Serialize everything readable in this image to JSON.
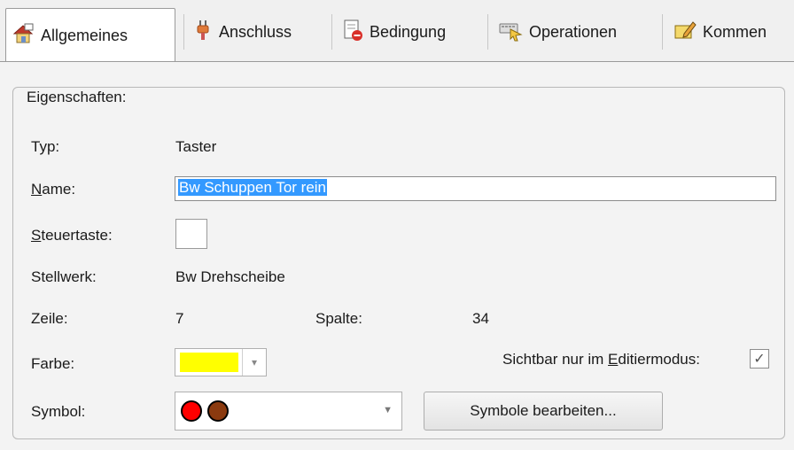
{
  "tabs": [
    {
      "label": "Allgemeines",
      "icon": "house-properties-icon",
      "active": true
    },
    {
      "label": "Anschluss",
      "icon": "plug-icon",
      "active": false
    },
    {
      "label": "Bedingung",
      "icon": "document-condition-icon",
      "active": false
    },
    {
      "label": "Operationen",
      "icon": "keyboard-pointer-icon",
      "active": false
    },
    {
      "label": "Kommen",
      "icon": "note-pencil-icon",
      "active": false
    }
  ],
  "group": {
    "title": "Eigenschaften:"
  },
  "fields": {
    "typ_label": "Typ:",
    "typ_value": "Taster",
    "name_label_u": "N",
    "name_label_rest": "ame:",
    "name_value": "Bw Schuppen Tor rein",
    "steuertaste_label_u": "S",
    "steuertaste_label_rest": "teuertaste:",
    "stellwerk_label": "Stellwerk:",
    "stellwerk_value": "Bw Drehscheibe",
    "zeile_label": "Zeile:",
    "zeile_value": "7",
    "spalte_label": "Spalte:",
    "spalte_value": "34",
    "farbe_label": "Farbe:",
    "farbe_color": "#ffff00",
    "sichtbar_label_pre": "Sichtbar nur im ",
    "sichtbar_label_u": "E",
    "sichtbar_label_rest": "ditiermodus:",
    "sichtbar_checked": true,
    "symbol_label": "Symbol:",
    "symbol_colors": [
      "#ff0000",
      "#8b3a0f"
    ],
    "symbol_button": "Symbole bearbeiten..."
  }
}
